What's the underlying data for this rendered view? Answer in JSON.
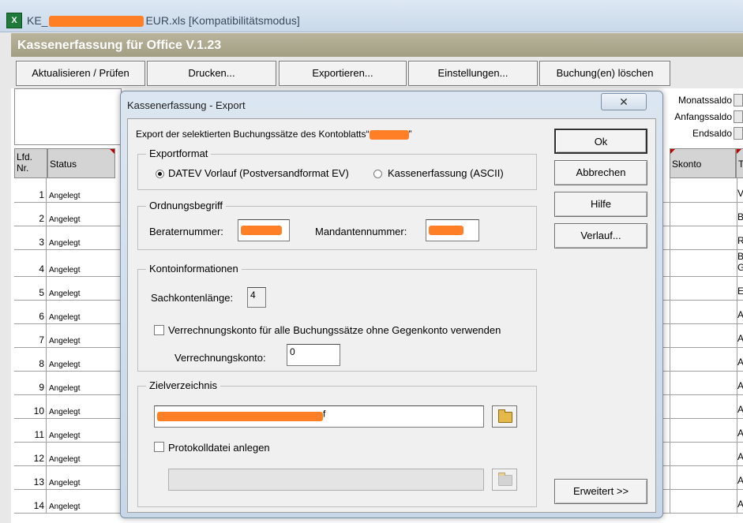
{
  "window": {
    "title_prefix": "KE_",
    "title_suffix": "EUR.xls  [Kompatibilitätsmodus]"
  },
  "app": {
    "title": "Kassenerfassung für Office V.1.23"
  },
  "toolbar": {
    "buttons": [
      "Aktualisieren / Prüfen",
      "Drucken...",
      "Exportieren...",
      "Einstellungen...",
      "Buchung(en)  löschen"
    ]
  },
  "saldo": {
    "monat": "Monatssaldo",
    "anfang": "Anfangssaldo",
    "end": "Endsaldo"
  },
  "grid": {
    "col_nr": "Lfd.\nNr.",
    "col_status": "Status",
    "col_skonto": "Skonto",
    "col_t": "T",
    "rows": [
      {
        "nr": "1",
        "status": "Angelegt",
        "t": "V"
      },
      {
        "nr": "2",
        "status": "Angelegt",
        "t": "B"
      },
      {
        "nr": "3",
        "status": "Angelegt",
        "t": "R"
      },
      {
        "nr": "4",
        "status": "Angelegt",
        "t": "B\nG"
      },
      {
        "nr": "5",
        "status": "Angelegt",
        "t": "E"
      },
      {
        "nr": "6",
        "status": "Angelegt",
        "t": "A"
      },
      {
        "nr": "7",
        "status": "Angelegt",
        "t": "A"
      },
      {
        "nr": "8",
        "status": "Angelegt",
        "t": "A"
      },
      {
        "nr": "9",
        "status": "Angelegt",
        "t": "A"
      },
      {
        "nr": "10",
        "status": "Angelegt",
        "t": "A"
      },
      {
        "nr": "11",
        "status": "Angelegt",
        "t": "A"
      },
      {
        "nr": "12",
        "status": "Angelegt",
        "t": "A"
      },
      {
        "nr": "13",
        "status": "Angelegt",
        "t": "A"
      },
      {
        "nr": "14",
        "status": "Angelegt",
        "t": "A"
      }
    ]
  },
  "dialog": {
    "title": "Kassenerfassung - Export",
    "close_glyph": "✕",
    "intro": "Export der selektierten Buchungssätze des Kontoblatts",
    "exportformat": {
      "legend": "Exportformat",
      "option1": "DATEV Vorlauf (Postversandformat EV)",
      "option2": "Kassenerfassung (ASCII)"
    },
    "ordnung": {
      "legend": "Ordnungsbegriff",
      "berater_label": "Beraternummer:",
      "mandant_label": "Mandantennummer:"
    },
    "konto": {
      "legend": "Kontoinformationen",
      "sachkonten_label": "Sachkontenlänge:",
      "sachkonten_value": "4",
      "verrechnung_check_label": "Verrechnungskonto für alle Buchungssätze ohne Gegenkonto verwenden",
      "verrechnung_label": "Verrechnungskonto:",
      "verrechnung_value": "0"
    },
    "ziel": {
      "legend": "Zielverzeichnis",
      "path_tail": "f",
      "protokoll_label": "Protokolldatei anlegen"
    },
    "buttons": {
      "ok": "Ok",
      "abbrechen": "Abbrechen",
      "hilfe": "Hilfe",
      "verlauf": "Verlauf...",
      "erweitert": "Erweitert >>"
    }
  }
}
